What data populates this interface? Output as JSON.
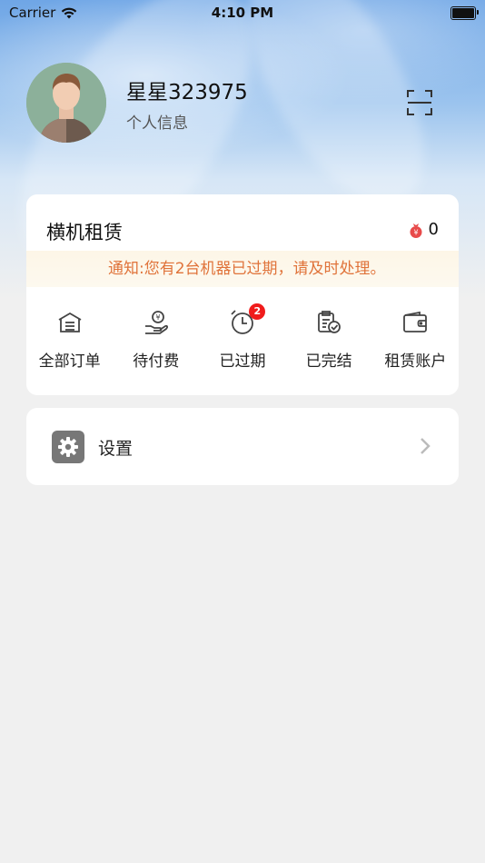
{
  "status_bar": {
    "carrier": "Carrier",
    "time": "4:10 PM"
  },
  "profile": {
    "name": "星星323975",
    "subtitle": "个人信息"
  },
  "rental": {
    "title": "横机租赁",
    "coin_count": "0",
    "notice": "通知:您有2台机器已过期，请及时处理。",
    "menu": [
      {
        "label": "全部订单",
        "icon": "warehouse-icon"
      },
      {
        "label": "待付费",
        "icon": "payment-hand-icon"
      },
      {
        "label": "已过期",
        "icon": "alarm-clock-icon",
        "badge": "2"
      },
      {
        "label": "已完结",
        "icon": "completed-doc-icon"
      },
      {
        "label": "租赁账户",
        "icon": "wallet-icon"
      }
    ]
  },
  "settings": {
    "label": "设置",
    "icon": "gear-icon"
  },
  "colors": {
    "notice_text": "#e0733a",
    "badge": "#f01b1b",
    "coin": "#e84a4a"
  }
}
